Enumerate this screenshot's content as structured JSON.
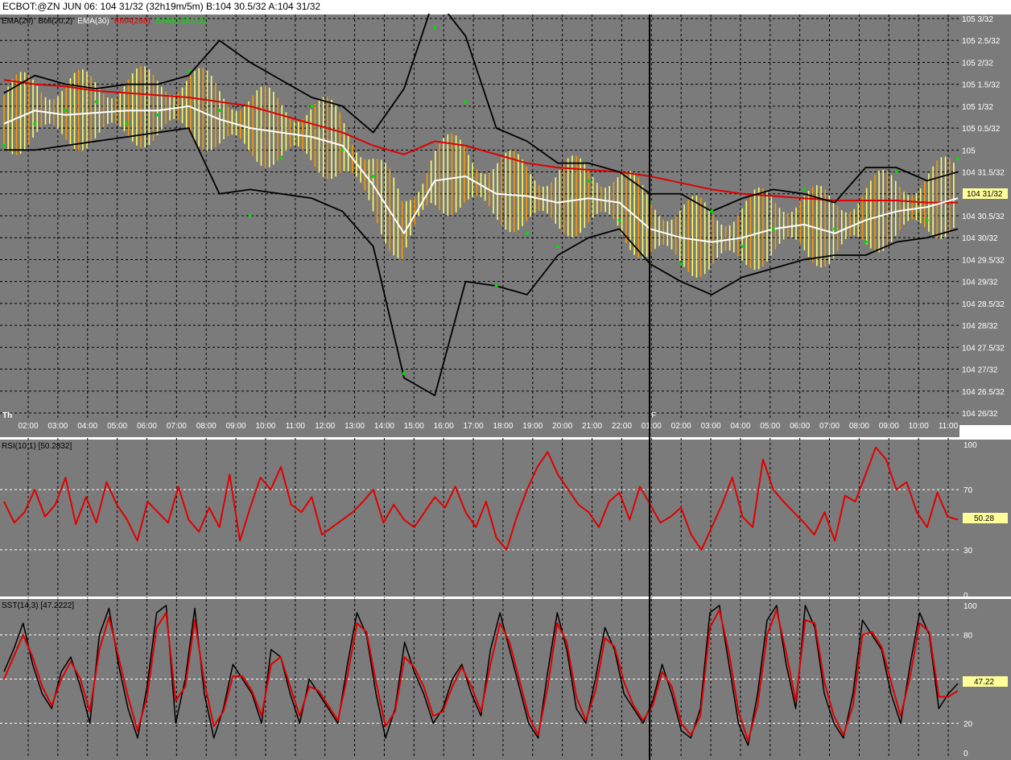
{
  "window": {
    "title": "ECBOT:@ZN   JUN 06: 104 31/32 (32h19m/5m)  B:104 30.5/32 A:104 31/32"
  },
  "colors": {
    "panel_bg": "#7b7b7b",
    "grid": "#000000",
    "price_ema_slow": "#e00000",
    "price_ema_fast": "#ffffff",
    "bollinger": "#000000",
    "sar": "#00dd00",
    "bar_up": "#ffff66",
    "bar_down": "#ff9900",
    "last_price_badge": "#ffff99"
  },
  "chart_data": [
    {
      "type": "line",
      "panel": "price",
      "legend": [
        {
          "text": "EMA(20)",
          "color": "#000000"
        },
        {
          "text": "Boll(20,2)",
          "color": "#000000"
        },
        {
          "text": "EMA(30)",
          "color": "#ffffff"
        },
        {
          "text": "EMA(288)",
          "color": "#e00000"
        },
        {
          "text": "SAR(0.02,0.2)",
          "color": "#00dd00"
        }
      ],
      "day_labels": [
        "Th",
        "F"
      ],
      "x_ticks": [
        "02:00",
        "03:00",
        "04:00",
        "05:00",
        "06:00",
        "07:00",
        "08:00",
        "09:00",
        "10:00",
        "11:00",
        "12:00",
        "13:00",
        "14:00",
        "15:00",
        "16:00",
        "17:00",
        "18:00",
        "19:00",
        "20:00",
        "21:00",
        "22:00",
        "01:00",
        "02:00",
        "03:00",
        "04:00",
        "05:00",
        "06:00",
        "07:00",
        "08:00",
        "09:00",
        "10:00",
        "11:00"
      ],
      "y_ticks": [
        "105 3/32",
        "105 2.5/32",
        "105 2/32",
        "105 1.5/32",
        "105 1/32",
        "105 0.5/32",
        "105",
        "104 31.5/32",
        "104 31/32",
        "104 30.5/32",
        "104 30/32",
        "104 29.5/32",
        "104 29/32",
        "104 28.5/32",
        "104 28/32",
        "104 27.5/32",
        "104 27/32",
        "104 26.5/32",
        "104 26/32"
      ],
      "ylim_32nds": [
        26,
        35
      ],
      "last_value_label": "104 31/32",
      "series": [
        {
          "id": "ema288",
          "color": "#e00000",
          "values": [
            33.6,
            33.5,
            33.45,
            33.35,
            33.3,
            33.25,
            33.2,
            33.1,
            33.0,
            32.8,
            32.6,
            32.4,
            32.1,
            31.9,
            32.2,
            32.1,
            31.9,
            31.7,
            31.6,
            31.55,
            31.5,
            31.4,
            31.25,
            31.1,
            31.0,
            30.95,
            30.9,
            30.85,
            30.85,
            30.85,
            30.8,
            30.8
          ]
        },
        {
          "id": "ema30",
          "color": "#ffffff",
          "values": [
            32.6,
            32.9,
            32.8,
            32.85,
            32.9,
            32.9,
            33.0,
            32.7,
            32.5,
            32.4,
            32.3,
            32.1,
            31.2,
            30.1,
            31.3,
            31.4,
            31.0,
            30.95,
            30.8,
            30.9,
            30.8,
            30.2,
            30.0,
            29.9,
            30.0,
            30.2,
            30.3,
            30.1,
            30.4,
            30.6,
            30.7,
            30.9
          ]
        },
        {
          "id": "boll_upper",
          "color": "#000000",
          "values": [
            33.3,
            33.7,
            33.5,
            33.4,
            33.5,
            33.5,
            33.7,
            34.5,
            34.0,
            33.6,
            33.2,
            33.0,
            32.4,
            33.4,
            35.5,
            34.6,
            32.5,
            32.2,
            31.7,
            31.7,
            31.5,
            31.0,
            31.0,
            30.6,
            30.9,
            31.1,
            31.0,
            30.8,
            31.6,
            31.6,
            31.3,
            31.5
          ]
        },
        {
          "id": "boll_lower",
          "color": "#000000",
          "values": [
            32.0,
            32.0,
            32.1,
            32.2,
            32.3,
            32.4,
            32.5,
            31.0,
            31.1,
            31.0,
            30.9,
            30.6,
            29.8,
            26.8,
            26.4,
            29.0,
            28.9,
            28.7,
            29.6,
            30.0,
            30.2,
            29.4,
            29.0,
            28.7,
            29.1,
            29.3,
            29.5,
            29.6,
            29.6,
            29.9,
            30.0,
            30.2
          ]
        },
        {
          "id": "sar",
          "color": "#00dd00",
          "values": [
            32.1,
            32.6,
            32.9,
            33.1,
            32.6,
            32.8,
            33.8,
            32.9,
            30.5,
            31.8,
            33.0,
            32.0,
            31.4,
            26.9,
            34.8,
            33.1,
            28.9,
            30.1,
            29.8,
            31.3,
            30.4,
            30.8,
            29.4,
            30.6,
            29.8,
            30.2,
            31.1,
            30.2,
            29.9,
            31.5,
            30.4,
            31.8
          ]
        }
      ]
    },
    {
      "type": "line",
      "panel": "rsi",
      "legend": [
        {
          "text": "RSI(10,1)  [50.2832]",
          "color": "#000000"
        }
      ],
      "y_ticks": [
        100,
        70,
        30,
        0
      ],
      "ylim": [
        0,
        100
      ],
      "last_value_label": "50.28",
      "series": [
        {
          "id": "rsi",
          "color": "#e00000",
          "values": [
            62,
            48,
            55,
            70,
            52,
            60,
            78,
            47,
            65,
            48,
            75,
            60,
            50,
            36,
            62,
            55,
            48,
            72,
            50,
            42,
            58,
            45,
            80,
            36,
            58,
            78,
            70,
            85,
            60,
            55,
            65,
            40,
            45,
            50,
            55,
            62,
            70,
            48,
            60,
            50,
            45,
            55,
            65,
            58,
            72,
            55,
            45,
            62,
            38,
            30,
            52,
            70,
            85,
            95,
            80,
            70,
            60,
            55,
            45,
            62,
            68,
            50,
            72,
            60,
            48,
            52,
            58,
            40,
            30,
            45,
            60,
            78,
            52,
            45,
            90,
            70,
            62,
            55,
            48,
            40,
            55,
            36,
            66,
            62,
            80,
            98,
            90,
            70,
            75,
            55,
            45,
            68,
            52,
            50
          ]
        }
      ]
    },
    {
      "type": "line",
      "panel": "sst",
      "legend": [
        {
          "text": "SST(14,3)  [47.2222]",
          "color": "#000000"
        }
      ],
      "y_ticks": [
        100,
        80,
        50,
        20,
        0
      ],
      "ylim": [
        0,
        100
      ],
      "last_value_label": "47.22",
      "series": [
        {
          "id": "sst_k",
          "color": "#000000",
          "values": [
            55,
            70,
            88,
            60,
            40,
            30,
            55,
            65,
            45,
            20,
            80,
            98,
            60,
            30,
            10,
            45,
            95,
            100,
            20,
            50,
            98,
            40,
            10,
            30,
            60,
            50,
            40,
            20,
            70,
            65,
            40,
            20,
            50,
            40,
            30,
            20,
            60,
            95,
            80,
            40,
            10,
            30,
            75,
            55,
            40,
            20,
            30,
            50,
            60,
            40,
            25,
            70,
            95,
            70,
            45,
            20,
            10,
            55,
            95,
            70,
            30,
            20,
            50,
            85,
            70,
            40,
            30,
            20,
            35,
            60,
            40,
            15,
            10,
            30,
            95,
            100,
            60,
            20,
            5,
            40,
            90,
            100,
            60,
            30,
            100,
            85,
            40,
            20,
            10,
            40,
            90,
            80,
            70,
            40,
            20,
            60,
            95,
            80,
            30,
            40,
            47
          ]
        },
        {
          "id": "sst_d",
          "color": "#e00000",
          "values": [
            50,
            65,
            80,
            65,
            45,
            32,
            50,
            62,
            50,
            28,
            70,
            92,
            65,
            38,
            15,
            38,
            85,
            95,
            35,
            45,
            90,
            48,
            18,
            28,
            52,
            52,
            42,
            25,
            60,
            65,
            45,
            25,
            45,
            42,
            32,
            22,
            52,
            88,
            82,
            48,
            18,
            28,
            65,
            58,
            45,
            25,
            28,
            45,
            58,
            45,
            28,
            60,
            88,
            75,
            50,
            25,
            12,
            45,
            88,
            75,
            38,
            22,
            42,
            78,
            72,
            48,
            32,
            22,
            32,
            55,
            45,
            20,
            12,
            25,
            85,
            97,
            68,
            28,
            8,
            32,
            80,
            97,
            68,
            35,
            90,
            88,
            48,
            25,
            12,
            32,
            80,
            82,
            72,
            48,
            25,
            52,
            88,
            82,
            38,
            38,
            42
          ]
        }
      ]
    }
  ]
}
